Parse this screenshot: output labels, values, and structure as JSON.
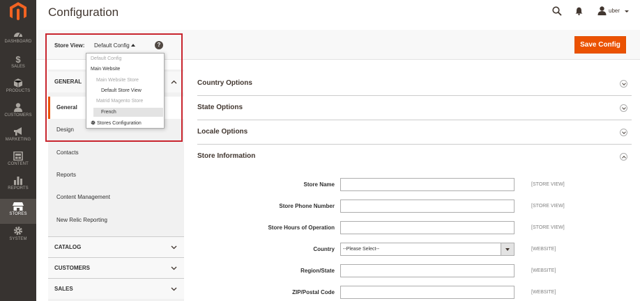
{
  "header": {
    "title": "Configuration",
    "user": "uber"
  },
  "nav": {
    "items": [
      {
        "label": "DASHBOARD",
        "icon": "dashboard-icon"
      },
      {
        "label": "SALES",
        "icon": "dollar-icon"
      },
      {
        "label": "PRODUCTS",
        "icon": "cube-icon"
      },
      {
        "label": "CUSTOMERS",
        "icon": "person-icon"
      },
      {
        "label": "MARKETING",
        "icon": "megaphone-icon"
      },
      {
        "label": "CONTENT",
        "icon": "layout-icon"
      },
      {
        "label": "REPORTS",
        "icon": "bar-chart-icon"
      },
      {
        "label": "STORES",
        "icon": "store-icon"
      },
      {
        "label": "SYSTEM",
        "icon": "gear-icon"
      }
    ],
    "active": "STORES"
  },
  "toolbar": {
    "save_label": "Save Config"
  },
  "store_view": {
    "label": "Store View:",
    "selected": "Default Config",
    "help": "?",
    "options": {
      "default_config": "Default Config",
      "main_website": "Main Website",
      "main_website_store": "Main Website Store",
      "default_store_view": "Default Store View",
      "matrid_store": "Matrid Magento Store",
      "french": "French",
      "stores_configuration": "Stores Configuration"
    }
  },
  "left_panel": {
    "general": {
      "title": "GENERAL",
      "items": [
        "General",
        "Design",
        "Contacts",
        "Reports",
        "Content Management",
        "New Relic Reporting"
      ]
    },
    "catalog": "CATALOG",
    "customers": "CUSTOMERS",
    "sales": "SALES"
  },
  "sections": {
    "country": "Country Options",
    "state": "State Options",
    "locale": "Locale Options",
    "store_info": "Store Information"
  },
  "store_info_fields": {
    "store_name": {
      "label": "Store Name",
      "scope": "[STORE VIEW]"
    },
    "phone": {
      "label": "Store Phone Number",
      "scope": "[STORE VIEW]"
    },
    "hours": {
      "label": "Store Hours of Operation",
      "scope": "[STORE VIEW]"
    },
    "country": {
      "label": "Country",
      "value": "--Please Select--",
      "scope": "[WEBSITE]"
    },
    "region": {
      "label": "Region/State",
      "scope": "[WEBSITE]"
    },
    "zip": {
      "label": "ZIP/Postal Code",
      "scope": "[WEBSITE]"
    }
  },
  "colors": {
    "nav_bg": "#373330",
    "accent": "#eb5202",
    "highlight": "#c8242d"
  }
}
